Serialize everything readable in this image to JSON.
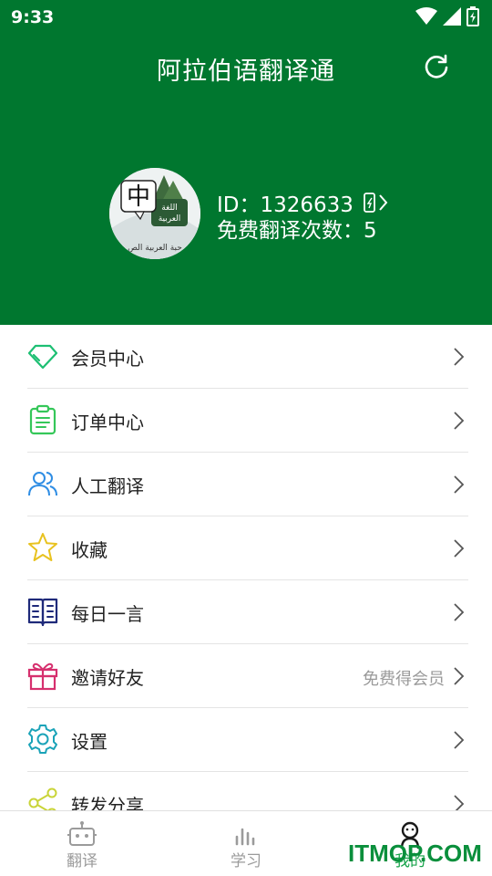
{
  "status_bar": {
    "time": "9:33"
  },
  "header": {
    "title": "阿拉伯语翻译通",
    "refresh_icon": "refresh-icon",
    "bg_color": "#00772f"
  },
  "profile": {
    "id_text": "ID：1326633",
    "free_count_text": "免费翻译次数：5",
    "avatar_label_zh": "中",
    "avatar_label_ar": "اللغة العربية"
  },
  "menu": [
    {
      "label": "会员中心",
      "icon": "diamond-icon",
      "color": "#1dbf73",
      "note": ""
    },
    {
      "label": "订单中心",
      "icon": "clipboard-icon",
      "color": "#35c759",
      "note": ""
    },
    {
      "label": "人工翻译",
      "icon": "people-icon",
      "color": "#2f8de4",
      "note": ""
    },
    {
      "label": "收藏",
      "icon": "star-icon",
      "color": "#e8c21f",
      "note": ""
    },
    {
      "label": "每日一言",
      "icon": "book-icon",
      "color": "#1f2a7a",
      "note": ""
    },
    {
      "label": "邀请好友",
      "icon": "gift-icon",
      "color": "#d6306e",
      "note": "免费得会员"
    },
    {
      "label": "设置",
      "icon": "gear-icon",
      "color": "#1aa3b8",
      "note": ""
    },
    {
      "label": "转发分享",
      "icon": "share-icon",
      "color": "#c9d438",
      "note": ""
    }
  ],
  "bottom_nav": [
    {
      "label": "翻译",
      "icon": "robot-icon"
    },
    {
      "label": "学习",
      "icon": "chart-icon"
    },
    {
      "label": "我的",
      "icon": "user-icon",
      "active": true
    }
  ],
  "watermark": "ITMOP.COM"
}
